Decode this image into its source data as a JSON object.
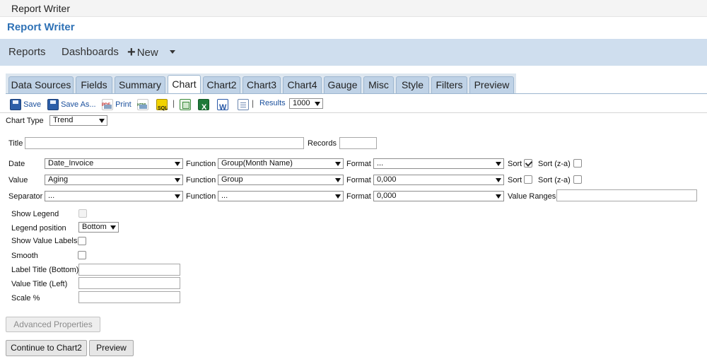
{
  "window": {
    "title": "Report Writer"
  },
  "app": {
    "title": "Report Writer"
  },
  "nav": {
    "reports": "Reports",
    "dashboards": "Dashboards",
    "new_plus": "+",
    "new": "New"
  },
  "tabs": [
    {
      "label": "Data Sources"
    },
    {
      "label": "Fields"
    },
    {
      "label": "Summary"
    },
    {
      "label": "Chart"
    },
    {
      "label": "Chart2"
    },
    {
      "label": "Chart3"
    },
    {
      "label": "Chart4"
    },
    {
      "label": "Gauge"
    },
    {
      "label": "Misc"
    },
    {
      "label": "Style"
    },
    {
      "label": "Filters"
    },
    {
      "label": "Preview"
    }
  ],
  "active_tab": "Chart",
  "toolbar": {
    "save": "Save",
    "save_as": "Save As...",
    "print": "Print",
    "separator": "|",
    "results_label": "Results",
    "results_value": "1000"
  },
  "chart_type": {
    "label": "Chart Type",
    "value": "Trend"
  },
  "title_row": {
    "title_label": "Title",
    "title_value": "",
    "records_label": "Records",
    "records_value": ""
  },
  "rows": [
    {
      "label": "Date",
      "field": "Date_Invoice",
      "function_label": "Function",
      "function": "Group(Month Name)",
      "format_label": "Format",
      "format": "...",
      "sort_label": "Sort",
      "sort_checked": true,
      "sort_za_label": "Sort (z-a)",
      "sort_za_checked": false
    },
    {
      "label": "Value",
      "field": "Aging",
      "function_label": "Function",
      "function": "Group",
      "format_label": "Format",
      "format": "0,000",
      "sort_label": "Sort",
      "sort_checked": false,
      "sort_za_label": "Sort (z-a)",
      "sort_za_checked": false
    },
    {
      "label": "Separator",
      "field": "...",
      "function_label": "Function",
      "function": "...",
      "format_label": "Format",
      "format": "0,000",
      "value_ranges_label": "Value Ranges",
      "value_ranges": ""
    }
  ],
  "options": {
    "show_legend": "Show Legend",
    "legend_position_label": "Legend position",
    "legend_position": "Bottom",
    "show_value_labels": "Show Value Labels",
    "smooth": "Smooth",
    "label_title_bottom": "Label Title (Bottom)",
    "value_title_left": "Value Title (Left)",
    "scale": "Scale %"
  },
  "buttons": {
    "advanced": "Advanced Properties",
    "continue": "Continue to Chart2",
    "preview": "Preview"
  }
}
